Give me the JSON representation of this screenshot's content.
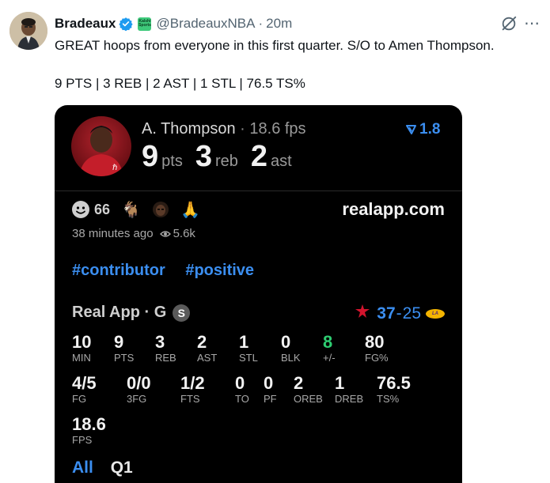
{
  "tweet": {
    "author_name": "Bradeaux",
    "affiliate_badge": "Kalshi Sports",
    "handle": "@BradeauxNBA",
    "separator": "·",
    "time": "20m",
    "text": "GREAT hoops from everyone in this first quarter. S/O to Amen Thompson.",
    "stat_line": "9 PTS | 3 REB | 2 AST | 1 STL | 76.5 TS%"
  },
  "card": {
    "player_name": "A. Thompson",
    "separator": "·",
    "fps": "18.6 fps",
    "rating": "1.8",
    "big_stats": [
      {
        "value": "9",
        "label": "pts"
      },
      {
        "value": "3",
        "label": "reb"
      },
      {
        "value": "2",
        "label": "ast"
      }
    ],
    "reactions": {
      "count": "66"
    },
    "site": "realapp.com",
    "posted": "38 minutes ago",
    "views": "5.6k",
    "tags": [
      "#contributor",
      "#positive"
    ],
    "game_label": "Real App · G",
    "badge": "S",
    "score_home": "37",
    "score_dash": "-",
    "score_away": "25",
    "row1": [
      {
        "value": "10",
        "label": "MIN"
      },
      {
        "value": "9",
        "label": "PTS"
      },
      {
        "value": "3",
        "label": "REB"
      },
      {
        "value": "2",
        "label": "AST"
      },
      {
        "value": "1",
        "label": "STL"
      },
      {
        "value": "0",
        "label": "BLK"
      },
      {
        "value": "8",
        "label": "+/-"
      },
      {
        "value": "80",
        "label": "FG%"
      }
    ],
    "row2": [
      {
        "value": "4/5",
        "label": "FG"
      },
      {
        "value": "0/0",
        "label": "3FG"
      },
      {
        "value": "1/2",
        "label": "FTS"
      },
      {
        "value": "0",
        "label": "TO"
      },
      {
        "value": "0",
        "label": "PF"
      },
      {
        "value": "2",
        "label": "OREB"
      },
      {
        "value": "1",
        "label": "DREB"
      },
      {
        "value": "76.5",
        "label": "TS%"
      }
    ],
    "row3": [
      {
        "value": "18.6",
        "label": "FPS"
      }
    ],
    "tabs": [
      "All",
      "Q1"
    ]
  },
  "colors": {
    "accent_blue": "#3b8ef0",
    "plus_minus_green": "#2ecc71",
    "rockets_red": "#d3142d"
  },
  "icons": [
    "verified-badge-icon",
    "grok-icon",
    "more-icon",
    "trend-arrow-icon",
    "smiley-icon",
    "goat-icon",
    "praying-hands-icon",
    "eye-icon",
    "rockets-logo-icon",
    "lakers-logo-icon"
  ]
}
